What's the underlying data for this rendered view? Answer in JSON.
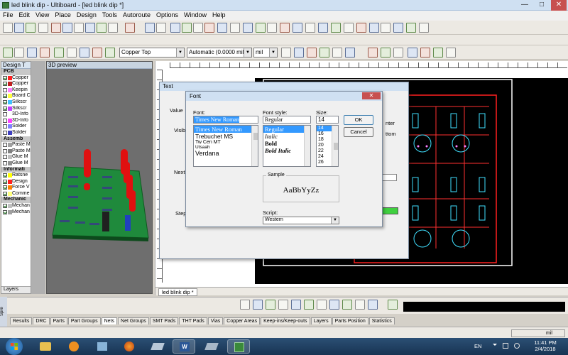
{
  "window": {
    "title": "led blink dip - Ultiboard - [led blink dip *]"
  },
  "menu": [
    "File",
    "Edit",
    "View",
    "Place",
    "Design",
    "Tools",
    "Autoroute",
    "Options",
    "Window",
    "Help"
  ],
  "toolbar": {
    "layer": "Copper Top",
    "trace_width": "Automatic (0.0000 mil",
    "unit": "mil"
  },
  "design_toolbox": {
    "title": "Design T",
    "items": [
      {
        "label": "PCB",
        "header": true
      },
      {
        "label": "Copper",
        "checked": true,
        "color": "#ff2020"
      },
      {
        "label": "Copper",
        "checked": true,
        "color": "#c02020"
      },
      {
        "label": "Keepin",
        "checked": false,
        "color": "#ff80ff"
      },
      {
        "label": "Board C",
        "checked": true,
        "color": "#ffff40"
      },
      {
        "label": "Silkscr",
        "checked": true,
        "color": "#40c0ff"
      },
      {
        "label": "Silkscr",
        "checked": true,
        "color": "#c040ff"
      },
      {
        "label": "3D-Info",
        "checked": false,
        "color": "#ffffff"
      },
      {
        "label": "3D-Info",
        "checked": false,
        "color": "#ff40ff"
      },
      {
        "label": "Solder",
        "checked": false,
        "color": "#8080ff"
      },
      {
        "label": "Solder",
        "checked": false,
        "color": "#4040c0"
      },
      {
        "label": "Assemb",
        "header": true
      },
      {
        "label": "Paste M",
        "checked": false,
        "color": "#a0a0a0"
      },
      {
        "label": "Paste M",
        "checked": false,
        "color": "#808080"
      },
      {
        "label": "Glue M",
        "checked": false,
        "color": "#c0c0c0"
      },
      {
        "label": "Glue M",
        "checked": false,
        "color": "#909090"
      },
      {
        "label": "Informati",
        "header": true
      },
      {
        "label": "Ratsne",
        "checked": true,
        "color": "#ffff00"
      },
      {
        "label": "Design",
        "checked": true,
        "color": "#ff2020"
      },
      {
        "label": "Force V",
        "checked": true,
        "color": "#ff8000"
      },
      {
        "label": "Comme",
        "checked": true,
        "color": "#ffff80"
      },
      {
        "label": "Mechanic",
        "header": true
      },
      {
        "label": "Mechan",
        "checked": true,
        "color": "#c0c0c0"
      },
      {
        "label": "Mechan",
        "checked": true,
        "color": "#a0a0a0"
      }
    ],
    "footer_tab": "Layers"
  },
  "preview": {
    "title": "3D preview"
  },
  "document_tab": "led blink dip *",
  "text_dialog": {
    "title": "Text",
    "value_label": "Value",
    "visible_label": "Visib",
    "next_label": "Next",
    "step_label": "Step",
    "right_labels": [
      "nter",
      "ttom"
    ]
  },
  "font_dialog": {
    "title": "Font",
    "font_label": "Font:",
    "font_value": "Times New Roman",
    "fonts": [
      "Times New Roman",
      "Trebuchet MS",
      "Tw Cen MT",
      "Utsaah",
      "Verdana"
    ],
    "style_label": "Font style:",
    "style_value": "Regular",
    "styles": [
      "Regular",
      "Italic",
      "Bold",
      "Bold Italic"
    ],
    "size_label": "Size:",
    "size_value": "14",
    "sizes": [
      "14",
      "16",
      "18",
      "20",
      "22",
      "24",
      "26"
    ],
    "ok_label": "OK",
    "cancel_label": "Cancel",
    "sample_label": "Sample",
    "sample_text": "AaBbYyZz",
    "script_label": "Script:",
    "script_value": "Western"
  },
  "bottom_tabs": [
    "Results",
    "DRC",
    "Parts",
    "Part Groups",
    "Nets",
    "Net Groups",
    "SMT Pads",
    "THT Pads",
    "Vias",
    "Copper Areas",
    "Keep-ins/Keep-outs",
    "Layers",
    "Parts Position",
    "Statistics"
  ],
  "status": {
    "unit": "mil",
    "spreadsheet_label": "Spre"
  },
  "taskbar": {
    "lang": "EN",
    "time": "11:41 PM",
    "date": "2/4/2018"
  }
}
